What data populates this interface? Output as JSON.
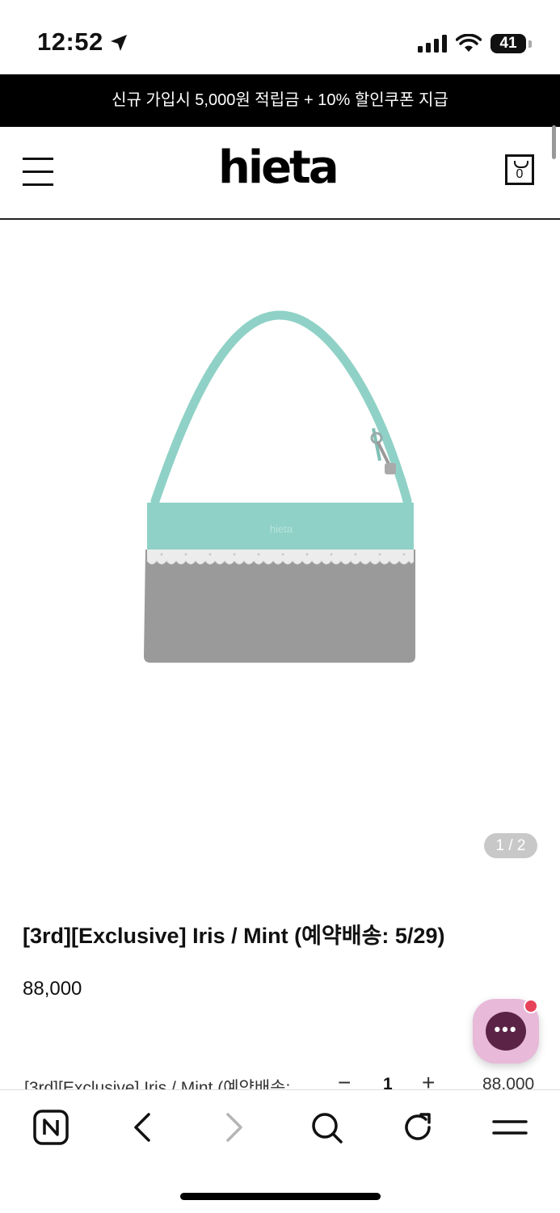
{
  "status_bar": {
    "time": "12:52",
    "battery": "41",
    "icons": [
      "location-arrow-icon",
      "signal-icon",
      "wifi-icon",
      "battery-icon"
    ]
  },
  "promo_banner": {
    "text": "신규 가입시 5,000원 적립금 + 10% 할인쿠폰 지급"
  },
  "header": {
    "logo": "hieta",
    "cart_count": "0",
    "icons": [
      "menu-icon",
      "cart-icon"
    ]
  },
  "product": {
    "image_counter": "1 / 2",
    "bag_logo": "hieta",
    "title": "[3rd][Exclusive] Iris / Mint (예약배송: 5/29)",
    "price": "88,000",
    "colors": {
      "strap": "#8fd1c6",
      "body": "#9a9a9a",
      "lace": "#ececec"
    }
  },
  "option": {
    "name": "[3rd][Exclusive] Iris / Mint (예약배송:",
    "minus": "−",
    "quantity": "1",
    "plus": "+",
    "price": "88,000"
  },
  "chat": {
    "icon": "chat-icon",
    "dots": "•••",
    "color": "#5b2446"
  },
  "bottom_bar": {
    "items": [
      "naver-home-icon",
      "back-icon",
      "forward-icon",
      "search-icon",
      "reload-icon",
      "menu-icon"
    ]
  }
}
